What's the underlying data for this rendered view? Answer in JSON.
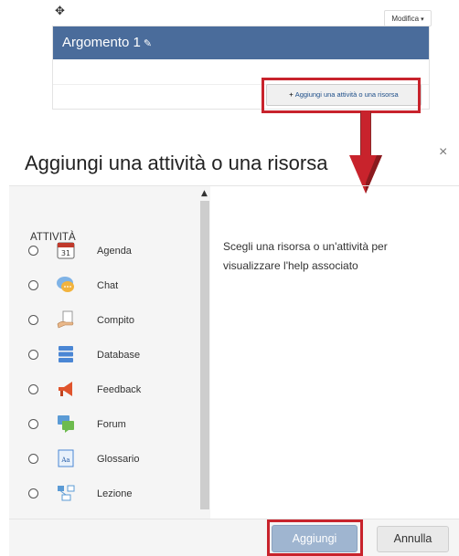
{
  "course": {
    "move_icon": "✥",
    "edit_menu_label": "Modifica",
    "edit_menu_caret": "▾",
    "topic_title": "Argomento 1",
    "pencil_icon": "✎",
    "add_activity_plus": "+",
    "add_activity_label": "Aggiungi una attività o una risorsa"
  },
  "modal": {
    "title": "Aggiungi una attività o una risorsa",
    "close_glyph": "×",
    "list_header": "ATTIVITÀ",
    "scroll_up_glyph": "▲",
    "items": [
      {
        "label": "Agenda",
        "icon": "calendar-icon",
        "icon_text": "31"
      },
      {
        "label": "Chat",
        "icon": "chat-icon"
      },
      {
        "label": "Compito",
        "icon": "assignment-icon"
      },
      {
        "label": "Database",
        "icon": "database-icon"
      },
      {
        "label": "Feedback",
        "icon": "megaphone-icon"
      },
      {
        "label": "Forum",
        "icon": "forum-icon"
      },
      {
        "label": "Glossario",
        "icon": "glossary-icon",
        "icon_text": "Aa"
      },
      {
        "label": "Lezione",
        "icon": "lesson-icon"
      }
    ],
    "help_text": "Scegli una risorsa o un'attività per visualizzare l'help associato",
    "add_button": "Aggiungi",
    "cancel_button": "Annulla"
  },
  "colors": {
    "topic_header": "#4a6c9b",
    "highlight": "#c8232c",
    "add_button_bg": "#9fb5d0"
  }
}
